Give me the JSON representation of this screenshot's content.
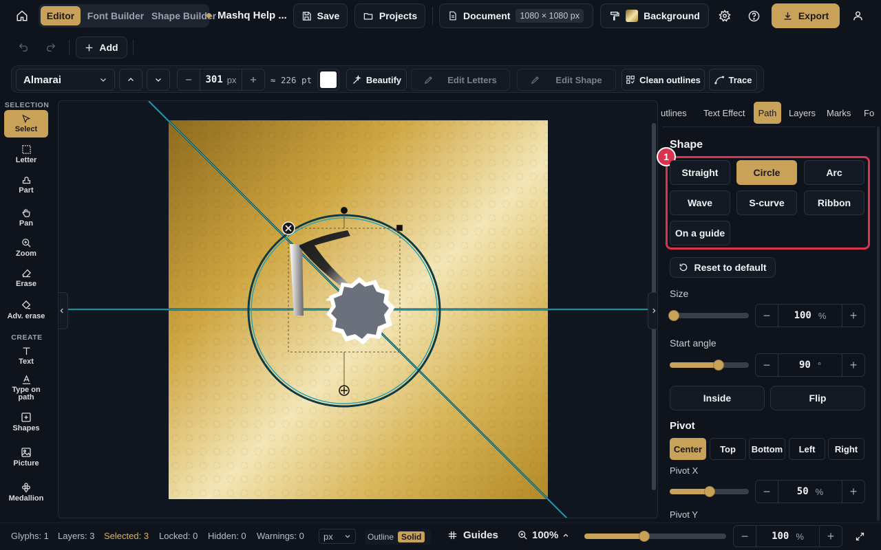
{
  "topbar": {
    "tabs": [
      {
        "label": "Editor",
        "active": true
      },
      {
        "label": "Font Builder",
        "active": false
      },
      {
        "label": "Shape Builder",
        "active": false
      }
    ],
    "project_name": "Mashq Help ...",
    "save_label": "Save",
    "projects_label": "Projects",
    "document_label": "Document",
    "document_size": "1080 × 1080 px",
    "background_label": "Background",
    "export_label": "Export"
  },
  "row2": {
    "add_label": "Add"
  },
  "toolbar": {
    "font_name": "Almarai",
    "size_value": "301",
    "size_unit": "px",
    "pt_value": "≈ 226 pt",
    "color": "#ffffff",
    "beautify_label": "Beautify",
    "edit_letters_label": "Edit Letters",
    "edit_shape_label": "Edit Shape",
    "clean_outlines_label": "Clean outlines",
    "trace_label": "Trace"
  },
  "left_sidebar": {
    "selection_heading": "SELECTION",
    "create_heading": "CREATE",
    "tools": [
      {
        "label": "Select",
        "icon": "cursor-icon",
        "active": true
      },
      {
        "label": "Letter",
        "icon": "letter-select-icon"
      },
      {
        "label": "Part",
        "icon": "part-icon"
      },
      {
        "label": "Pan",
        "icon": "hand-icon"
      },
      {
        "label": "Zoom",
        "icon": "zoom-icon"
      },
      {
        "label": "Erase",
        "icon": "eraser-icon"
      },
      {
        "label": "Adv. erase",
        "icon": "adv-erase-icon"
      },
      {
        "label": "Text",
        "icon": "text-icon"
      },
      {
        "label": "Type on path",
        "icon": "type-on-path-icon"
      },
      {
        "label": "Shapes",
        "icon": "shapes-icon"
      },
      {
        "label": "Picture",
        "icon": "picture-icon"
      },
      {
        "label": "Medallion",
        "icon": "medallion-icon"
      }
    ]
  },
  "right_panel": {
    "tabs": [
      {
        "label": "utlines",
        "active": false
      },
      {
        "label": "Text Effect",
        "active": false
      },
      {
        "label": "Path",
        "active": true
      },
      {
        "label": "Layers",
        "active": false
      },
      {
        "label": "Marks",
        "active": false
      },
      {
        "label": "Fo",
        "active": false
      }
    ],
    "shape_heading": "Shape",
    "callout_number": "1",
    "shapes": [
      {
        "label": "Straight",
        "active": false
      },
      {
        "label": "Circle",
        "active": true
      },
      {
        "label": "Arc",
        "active": false
      },
      {
        "label": "Wave",
        "active": false
      },
      {
        "label": "S-curve",
        "active": false
      },
      {
        "label": "Ribbon",
        "active": false
      },
      {
        "label": "On a guide",
        "active": false
      }
    ],
    "reset_label": "Reset to default",
    "size_label": "Size",
    "size_value": "100",
    "size_unit": "%",
    "size_fraction": 0.05,
    "start_angle_label": "Start angle",
    "start_angle_value": "90",
    "start_angle_unit": "°",
    "start_angle_fraction": 0.62,
    "inside_label": "Inside",
    "flip_label": "Flip",
    "pivot_heading": "Pivot",
    "pivot_options": [
      {
        "label": "Center",
        "active": true
      },
      {
        "label": "Top",
        "active": false
      },
      {
        "label": "Bottom",
        "active": false
      },
      {
        "label": "Left",
        "active": false
      },
      {
        "label": "Right",
        "active": false
      }
    ],
    "pivot_x_label": "Pivot X",
    "pivot_x_value": "50",
    "pivot_x_unit": "%",
    "pivot_x_fraction": 0.5,
    "pivot_y_label": "Pivot Y"
  },
  "status": {
    "glyphs": "Glyphs: 1",
    "layers": "Layers: 3",
    "selected": "Selected: 3",
    "locked": "Locked: 0",
    "hidden": "Hidden: 0",
    "warnings": "Warnings: 0",
    "unit": "px",
    "outline_label": "Outline",
    "solid_label": "Solid",
    "guides_label": "Guides",
    "zoom_value": "100%",
    "zoom_fraction": 0.42,
    "zoom_field": "100",
    "zoom_unit": "%"
  },
  "colors": {
    "accent": "#c9a25a",
    "highlight": "#d8344f",
    "guide": "#2aa6b5"
  }
}
